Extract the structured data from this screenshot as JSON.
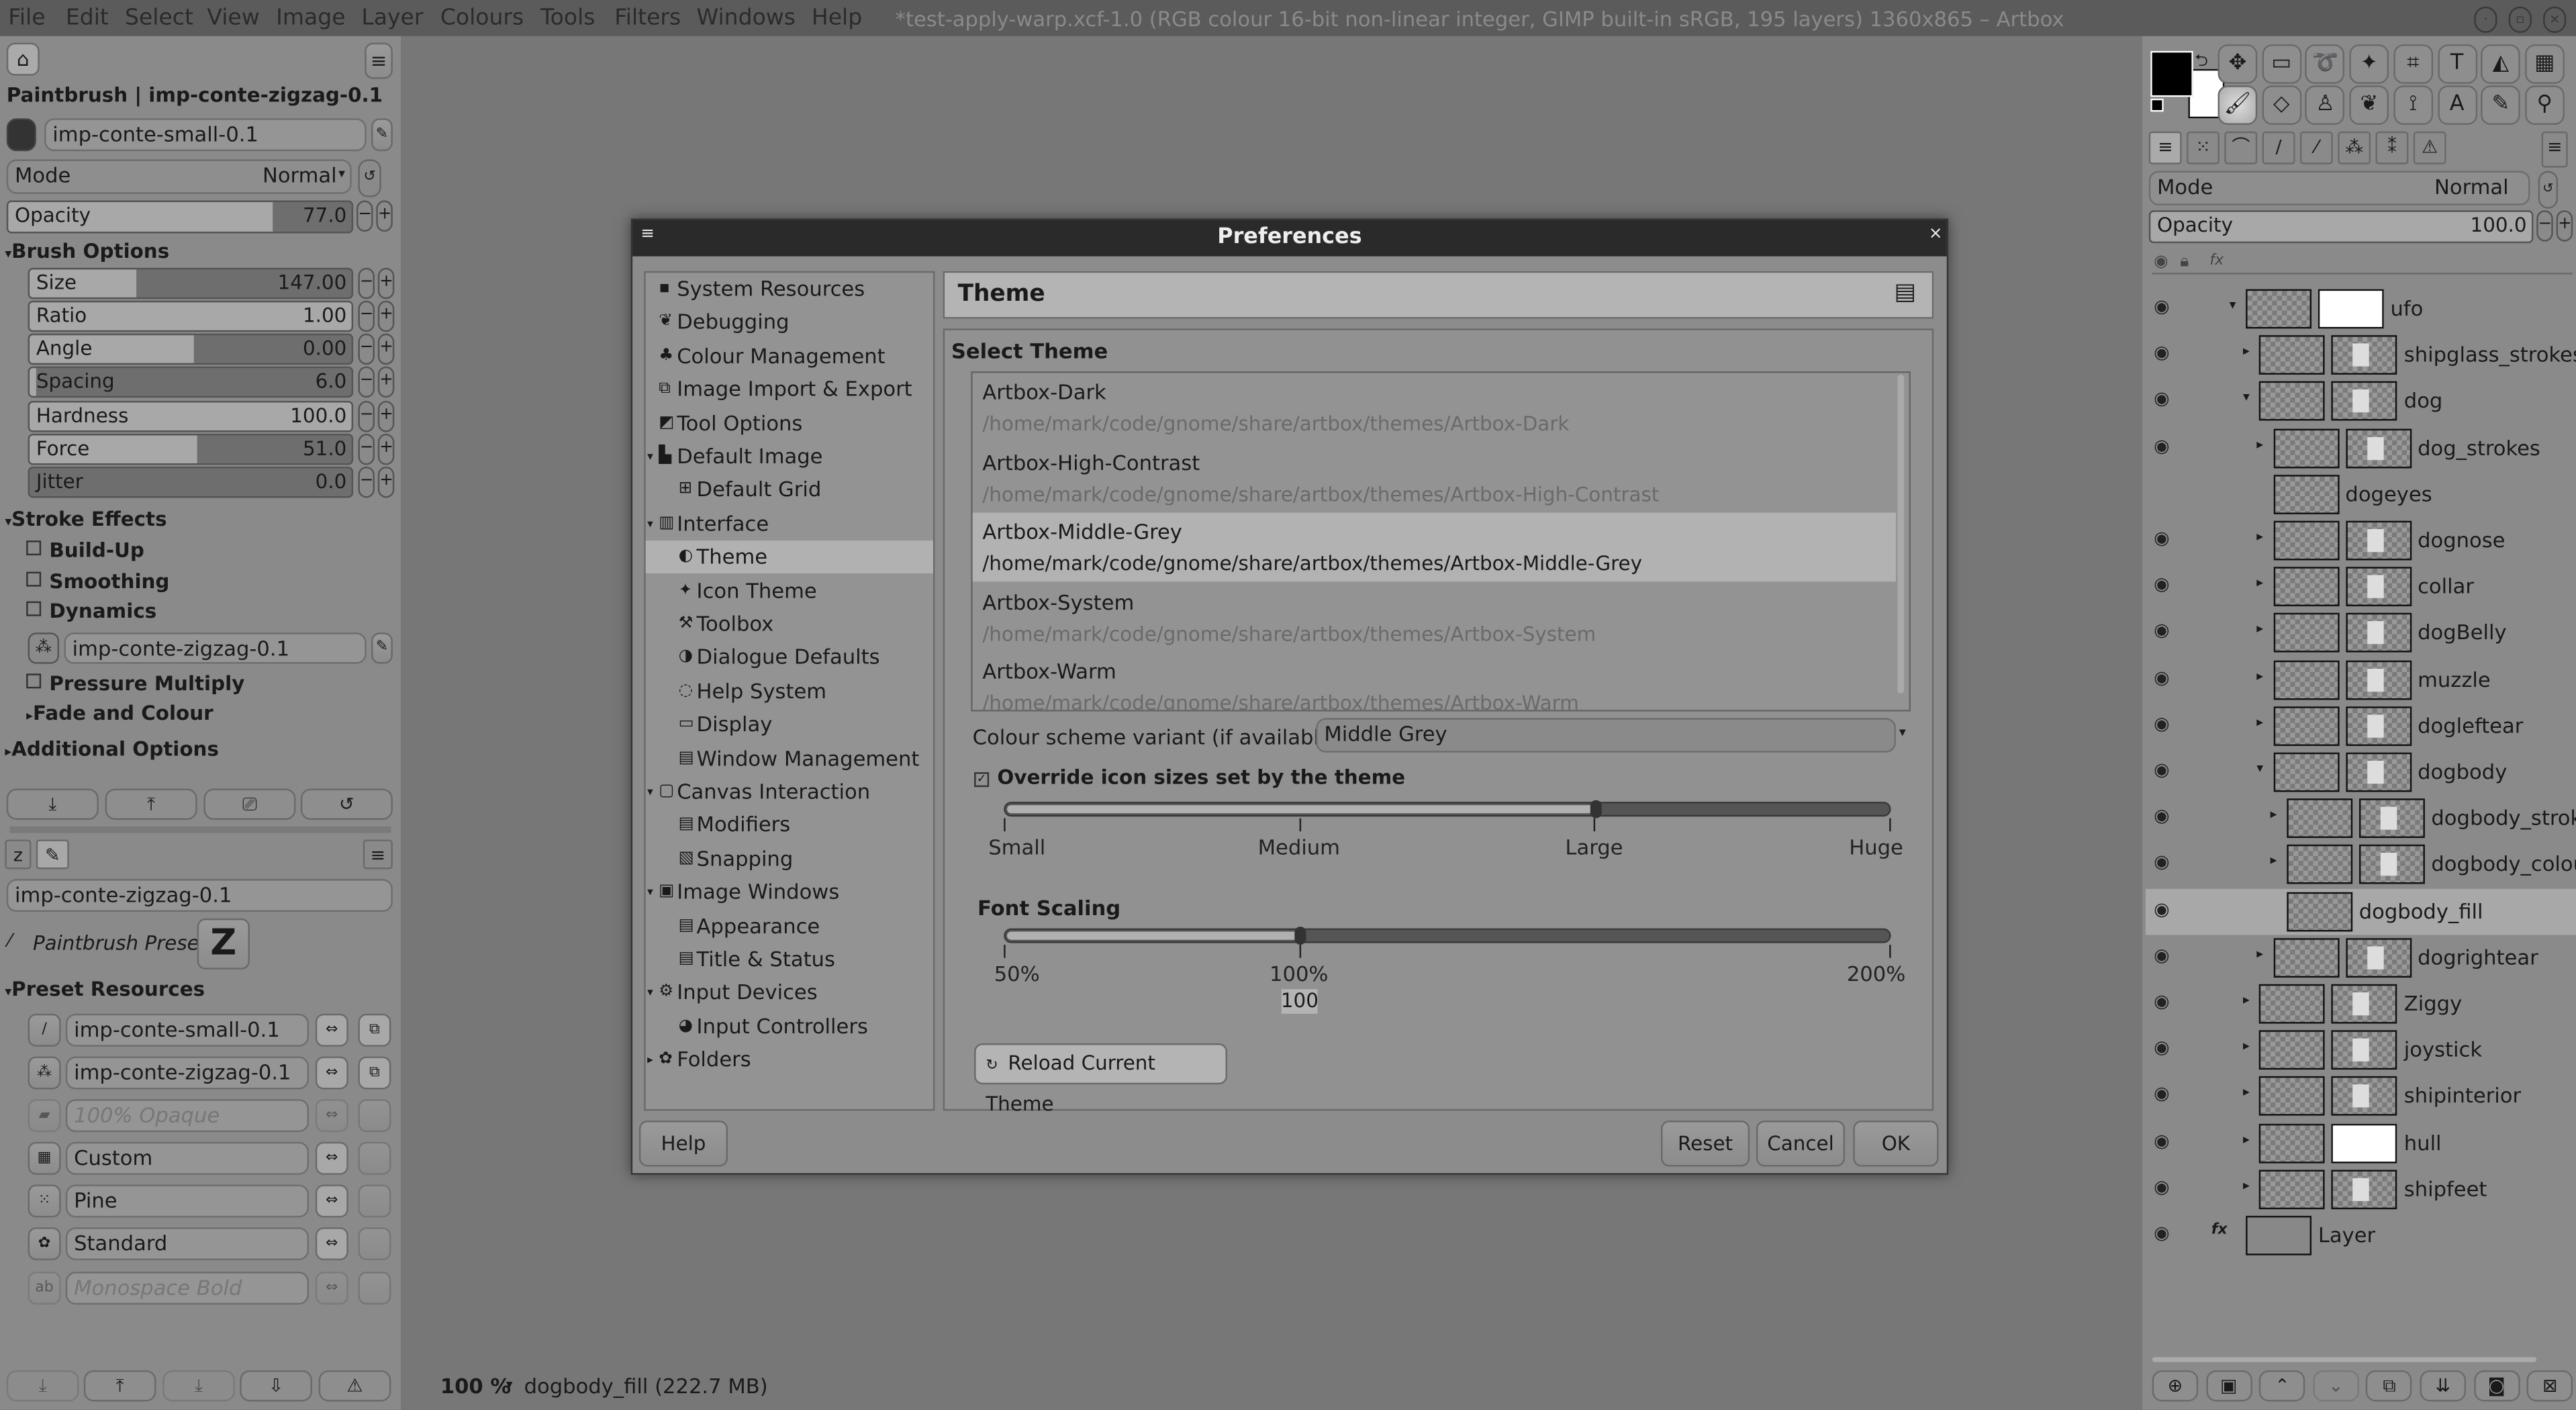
{
  "menubar": {
    "items": [
      "File",
      "Edit",
      "Select",
      "View",
      "Image",
      "Layer",
      "Colours",
      "Tools",
      "Filters",
      "Windows",
      "Help"
    ]
  },
  "window_title": "*test-apply-warp.xcf-1.0 (RGB colour 16-bit non-linear integer, GIMP built-in sRGB, 195 layers) 1360x865 – Artbox",
  "window_controls": [
    "minimize",
    "maximize",
    "close"
  ],
  "tool_options": {
    "title": "Paintbrush | imp-conte-zigzag-0.1",
    "brush": "imp-conte-small-0.1",
    "mode_label": "Mode",
    "mode_value": "Normal",
    "opacity_label": "Opacity",
    "opacity_value": "77.0",
    "opacity_fill": 0.77,
    "brush_options_label": "Brush Options",
    "sliders": [
      {
        "label": "Size",
        "value": "147.00",
        "fill": 0.33
      },
      {
        "label": "Ratio",
        "value": "1.00",
        "fill": 1.0
      },
      {
        "label": "Angle",
        "value": "0.00",
        "fill": 0.51
      },
      {
        "label": "Spacing",
        "value": "6.0",
        "fill": 0.02
      },
      {
        "label": "Hardness",
        "value": "100.0",
        "fill": 1.0
      },
      {
        "label": "Force",
        "value": "51.0",
        "fill": 0.52
      },
      {
        "label": "Jitter",
        "value": "0.0",
        "fill": 0.0
      }
    ],
    "stroke_effects_label": "Stroke Effects",
    "build_up": "Build-Up",
    "smoothing": "Smoothing",
    "dynamics": "Dynamics",
    "dynamics_value": "imp-conte-zigzag-0.1",
    "pressure_multiply": "Pressure Multiply",
    "fade_colour": "Fade and Colour",
    "additional_options": "Additional Options"
  },
  "preset_editor": {
    "name": "imp-conte-zigzag-0.1",
    "preset_label": "Paintbrush Preset",
    "resources_label": "Preset Resources",
    "resources": [
      {
        "value": "imp-conte-small-0.1",
        "enabled": true
      },
      {
        "value": "imp-conte-zigzag-0.1",
        "enabled": true
      },
      {
        "value": "100% Opaque",
        "enabled": false
      },
      {
        "value": "Custom",
        "enabled": true
      },
      {
        "value": "Pine",
        "enabled": true
      },
      {
        "value": "Standard",
        "enabled": true
      },
      {
        "value": "Monospace Bold",
        "enabled": false
      }
    ]
  },
  "statusbar": {
    "zoom": "100 %",
    "info": "dogbody_fill (222.7 MB)"
  },
  "preferences": {
    "title": "Preferences",
    "nav": [
      {
        "label": "System Resources",
        "depth": 0,
        "icon": "chip-icon"
      },
      {
        "label": "Debugging",
        "depth": 0,
        "icon": "bug-icon"
      },
      {
        "label": "Colour Management",
        "depth": 0,
        "icon": "colour-icon"
      },
      {
        "label": "Image Import & Export",
        "depth": 0,
        "icon": "import-icon"
      },
      {
        "label": "Tool Options",
        "depth": 0,
        "icon": "tool-options-icon"
      },
      {
        "label": "Default Image",
        "depth": 0,
        "icon": "image-icon",
        "expanded": true
      },
      {
        "label": "Default Grid",
        "depth": 1,
        "icon": "grid-icon"
      },
      {
        "label": "Interface",
        "depth": 0,
        "icon": "interface-icon",
        "expanded": true
      },
      {
        "label": "Theme",
        "depth": 1,
        "icon": "theme-icon",
        "selected": true
      },
      {
        "label": "Icon Theme",
        "depth": 1,
        "icon": "icon-theme-icon"
      },
      {
        "label": "Toolbox",
        "depth": 1,
        "icon": "toolbox-icon"
      },
      {
        "label": "Dialogue Defaults",
        "depth": 1,
        "icon": "dialog-icon"
      },
      {
        "label": "Help System",
        "depth": 1,
        "icon": "help-icon"
      },
      {
        "label": "Display",
        "depth": 1,
        "icon": "display-icon"
      },
      {
        "label": "Window Management",
        "depth": 1,
        "icon": "window-icon"
      },
      {
        "label": "Canvas Interaction",
        "depth": 0,
        "icon": "canvas-icon",
        "expanded": true
      },
      {
        "label": "Modifiers",
        "depth": 1,
        "icon": "modifiers-icon"
      },
      {
        "label": "Snapping",
        "depth": 1,
        "icon": "snap-icon"
      },
      {
        "label": "Image Windows",
        "depth": 0,
        "icon": "image-windows-icon",
        "expanded": true
      },
      {
        "label": "Appearance",
        "depth": 1,
        "icon": "appearance-icon"
      },
      {
        "label": "Title & Status",
        "depth": 1,
        "icon": "title-icon"
      },
      {
        "label": "Input Devices",
        "depth": 0,
        "icon": "input-icon",
        "expanded": true
      },
      {
        "label": "Input Controllers",
        "depth": 1,
        "icon": "controller-icon"
      },
      {
        "label": "Folders",
        "depth": 0,
        "icon": "folder-icon",
        "expanded": false
      }
    ],
    "header": "Theme",
    "select_theme_label": "Select Theme",
    "themes": [
      {
        "name": "Artbox-Dark",
        "path": "/home/mark/code/gnome/share/artbox/themes/Artbox-Dark"
      },
      {
        "name": "Artbox-High-Contrast",
        "path": "/home/mark/code/gnome/share/artbox/themes/Artbox-High-Contrast"
      },
      {
        "name": "Artbox-Middle-Grey",
        "path": "/home/mark/code/gnome/share/artbox/themes/Artbox-Middle-Grey",
        "selected": true
      },
      {
        "name": "Artbox-System",
        "path": "/home/mark/code/gnome/share/artbox/themes/Artbox-System"
      },
      {
        "name": "Artbox-Warm",
        "path": "/home/mark/code/gnome/share/artbox/themes/Artbox-Warm"
      }
    ],
    "colour_scheme_label": "Colour scheme variant (if available)",
    "colour_scheme_value": "Middle Grey",
    "override_icons_label": "Override icon sizes set by the theme",
    "override_icons_checked": true,
    "icon_size_ticks": [
      "Small",
      "Medium",
      "Large",
      "Huge"
    ],
    "icon_size_value": "Large",
    "font_scaling_label": "Font Scaling",
    "font_scale_ticks": [
      "50%",
      "100%",
      "200%"
    ],
    "font_scale_value": "100",
    "font_scale_range": [
      50,
      200
    ],
    "reload_label": "Reload Current Theme",
    "help_label": "Help",
    "reset_label": "Reset",
    "cancel_label": "Cancel",
    "ok_label": "OK"
  },
  "layers_panel": {
    "mode_label": "Mode",
    "mode_value": "Normal",
    "opacity_label": "Opacity",
    "opacity_value": "100.0",
    "layers": [
      {
        "name": "ufo",
        "depth": 0,
        "expander": "open",
        "visible": true,
        "mask": "white"
      },
      {
        "name": "shipglass_strokes",
        "depth": 1,
        "expander": "closed",
        "visible": true,
        "mask": "partial"
      },
      {
        "name": "dog",
        "depth": 1,
        "expander": "open",
        "visible": true,
        "mask": "partial"
      },
      {
        "name": "dog_strokes",
        "depth": 2,
        "expander": "closed",
        "visible": true,
        "mask": "partial"
      },
      {
        "name": "dogeyes",
        "depth": 2,
        "visible": false
      },
      {
        "name": "dognose",
        "depth": 2,
        "expander": "closed",
        "visible": true,
        "mask": "partial"
      },
      {
        "name": "collar",
        "depth": 2,
        "expander": "closed",
        "visible": true,
        "mask": "partial"
      },
      {
        "name": "dogBelly",
        "depth": 2,
        "expander": "closed",
        "visible": true,
        "mask": "partial"
      },
      {
        "name": "muzzle",
        "depth": 2,
        "expander": "closed",
        "visible": true,
        "mask": "partial"
      },
      {
        "name": "dogleftear",
        "depth": 2,
        "expander": "closed",
        "visible": true,
        "mask": "partial"
      },
      {
        "name": "dogbody",
        "depth": 2,
        "expander": "open",
        "visible": true,
        "mask": "partial"
      },
      {
        "name": "dogbody_strokes",
        "depth": 3,
        "expander": "closed",
        "visible": true,
        "mask": "partial"
      },
      {
        "name": "dogbody_colour",
        "depth": 3,
        "expander": "closed",
        "visible": true,
        "mask": "partial"
      },
      {
        "name": "dogbody_fill",
        "depth": 3,
        "visible": true,
        "selected": true
      },
      {
        "name": "dogrightear",
        "depth": 2,
        "expander": "closed",
        "visible": true,
        "mask": "partial"
      },
      {
        "name": "Ziggy",
        "depth": 1,
        "expander": "closed",
        "visible": true,
        "mask": "partial"
      },
      {
        "name": "joystick",
        "depth": 1,
        "expander": "closed",
        "visible": true,
        "mask": "partial"
      },
      {
        "name": "shipinterior",
        "depth": 1,
        "expander": "closed",
        "visible": true,
        "mask": "partial"
      },
      {
        "name": "hull",
        "depth": 1,
        "expander": "closed",
        "visible": true,
        "mask": "white"
      },
      {
        "name": "shipfeet",
        "depth": 1,
        "expander": "closed",
        "visible": true,
        "mask": "partial"
      },
      {
        "name": "Layer",
        "depth": 0,
        "visible": true,
        "fx": true,
        "plain": true
      }
    ]
  },
  "toolbox": {
    "fg_color": "#000000",
    "bg_color": "#ffffff",
    "row1": [
      "move-icon",
      "rect-select-icon",
      "lasso-icon",
      "fuzzy-select-icon",
      "crop-icon",
      "transform-icon",
      "warp-icon",
      "fill-icon"
    ],
    "row1_glyphs": [
      "✥",
      "▭",
      "➰",
      "✦",
      "⌗",
      "T",
      "◭",
      "▦"
    ],
    "row2": [
      "paintbrush-icon",
      "eraser-icon",
      "clone-icon",
      "smudge-icon",
      "paths-icon",
      "text-icon",
      "color-picker-icon",
      "zoom-icon"
    ],
    "row2_glyphs": [
      "🖌",
      "◇",
      "♙",
      "❦",
      "⟟",
      "A",
      "✎",
      "⚲"
    ],
    "tabs": [
      "layers-icon",
      "channels-icon",
      "paths-tab-icon",
      "brushes-icon",
      "dynamics-icon",
      "patterns-icon",
      "gradients-icon",
      "warning-icon"
    ],
    "tab_glyphs": [
      "≡",
      "⁙",
      "⌒",
      "/",
      "⁄",
      "⁂",
      "⁑",
      "⚠"
    ]
  }
}
